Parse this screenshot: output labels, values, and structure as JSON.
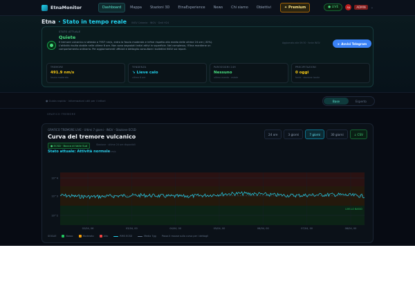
{
  "brand": {
    "name": "EtnaMonitor"
  },
  "nav": {
    "items": [
      "Dashboard",
      "Mappa",
      "Stazioni 3D",
      "EtnaExperience",
      "News",
      "Chi siamo",
      "Obiettivi"
    ],
    "premium": "✦ Premium",
    "live": "● LIVE",
    "avatar": "SA",
    "admin": "ADMIN",
    "chevron": "⌄"
  },
  "hero": {
    "title_a": "Etna",
    "title_b": "· Stato in tempo reale",
    "meta": "INGV Catania · INGV · Dati H24",
    "state_label": "STATO ATTUALE",
    "state_value": "Quiete",
    "description": "Il tremore vulcanico si attesta a 7957 nm/s, entro la fascia moderata e infine rispetto alla media delle ultime 24 ore (-32%). L'attività risulta stabile nelle ultime 6 ore. Non sono segnalati indizi attivi in superficie. Nel complesso, l'Etna mantiene un comportamento ordinario. Per aggiornamenti ufficiali e dettaglio consultare i bollettini INGV sui report.",
    "updated": "Aggiornato alle 09:30 · fonte INGV",
    "telegram": "Avvisi Telegram",
    "metrics": [
      {
        "label": "TREMORE",
        "value": "491.9 nm/s",
        "sub": "fascia moderata",
        "color": "#facc15"
      },
      {
        "label": "TENDENZA",
        "value": "↘ Lieve calo",
        "sub": "ultime 6 ore",
        "color": "#22d3ee"
      },
      {
        "label": "PAROSSISMI 24H",
        "value": "Nessuno",
        "sub": "ultimo evento · estate",
        "color": "#4ade80"
      },
      {
        "label": "PRECIPITAZIONI",
        "value": "0 oggi",
        "sub": "fonte · stazione locale",
        "color": "#facc15"
      }
    ]
  },
  "strip": {
    "crumb": "● Guida rapida · informazioni utili per i lettori",
    "modes": [
      "Base",
      "Esperto"
    ]
  },
  "section": {
    "label": "GRAFICO TREMORE"
  },
  "panel": {
    "subtitle": "GRAFICO TREMORE LIVE · Ultimi 7 giorni · INGV · Stazione ECSD",
    "title": "Curva del tremore vulcanico",
    "chip": "● ECSD · Bocca di Valle Sud",
    "note": "Stazione · ultime 24 ore disponibili",
    "state": "Stato attuale: Attività normale",
    "state_sub": "491.9 nm/s",
    "ranges": [
      "24 ore",
      "3 giorni",
      "7 giorni",
      "30 giorni",
      "↓ CSV"
    ],
    "active_range": 2
  },
  "chart_data": {
    "type": "line",
    "title": "Curva del tremore vulcanico",
    "xlabel": "",
    "ylabel": "",
    "y_ticks": [
      "10^4",
      "10^3",
      "10^2"
    ],
    "x_ticks": [
      "02/04, 06",
      "03/04, 00",
      "04/04, 00",
      "05/04, 00",
      "06/04, 00",
      "07/04, 00",
      "08/04, 00"
    ],
    "bands": [
      {
        "name": "Basso",
        "color": "#1f6b3a"
      },
      {
        "name": "Moderato",
        "color": "#b45309"
      },
      {
        "name": "Alto",
        "color": "#b91c1c"
      }
    ],
    "series": [
      {
        "name": "RMS ECSD",
        "color": "#22d3ee",
        "level": 0.5
      }
    ],
    "legend": [
      "Basso",
      "Moderato",
      "Alto",
      "RMS ECSD",
      "Media 7gg"
    ],
    "legend_extra": "Passa il mouse sulla curva per i dettagli",
    "legend_label": "SOGLIE",
    "band_label": "LIVELLO BASSO"
  },
  "colors": {
    "accent": "#22d3ee",
    "ok": "#4ade80",
    "warn": "#facc15",
    "premium": "#fde68a"
  }
}
